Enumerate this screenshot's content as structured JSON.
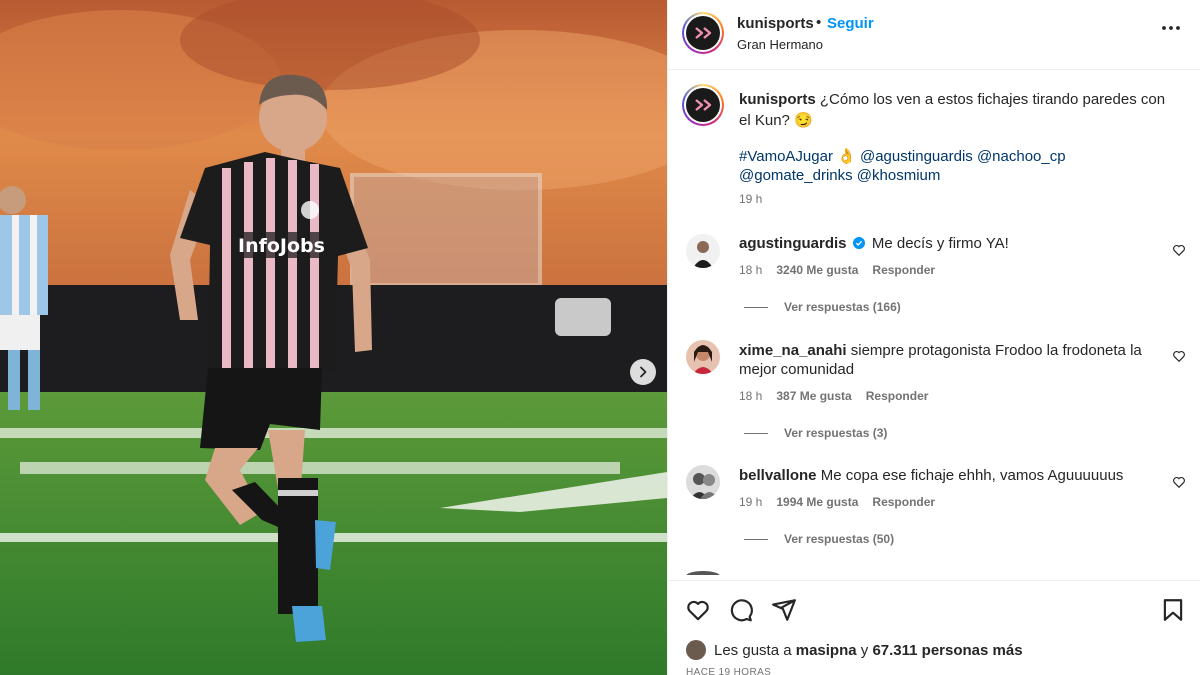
{
  "post": {
    "account": "kunisports",
    "follow_label": "Seguir",
    "subtitle": "Gran Hermano",
    "more_label": "•••"
  },
  "caption": {
    "username": "kunisports",
    "text": "¿Cómo los ven a estos fichajes tirando paredes con el Kun? 😏",
    "tags": [
      "#VamoAJugar",
      "👌",
      "@agustinguardis",
      "@nachoo_cp",
      "@gomate_drinks",
      "@khosmium"
    ],
    "time": "19 h"
  },
  "comments": [
    {
      "username": "agustinguardis",
      "verified": true,
      "text": "Me decís y firmo YA!",
      "time": "18 h",
      "likes": "3240 Me gusta",
      "reply_label": "Responder",
      "replies": "Ver respuestas (166)"
    },
    {
      "username": "xime_na_anahi",
      "verified": false,
      "text": "siempre protagonista Frodoo la frodoneta la mejor comunidad",
      "time": "18 h",
      "likes": "387 Me gusta",
      "reply_label": "Responder",
      "replies": "Ver respuestas (3)"
    },
    {
      "username": "bellvallone",
      "verified": false,
      "text": "Me copa ese fichaje ehhh, vamos Aguuuuuus",
      "time": "19 h",
      "likes": "1994 Me gusta",
      "reply_label": "Responder",
      "replies": "Ver respuestas (50)"
    }
  ],
  "likes": {
    "prefix": "Les gusta a",
    "user": "masipna",
    "connector": "y",
    "count": "67.311 personas más"
  },
  "date_label": "HACE 19 HORAS",
  "jersey_sponsor": "InfoJobs",
  "colors": {
    "link": "#0095f6",
    "tag": "#00376b",
    "muted": "#737373",
    "text": "#262626"
  }
}
